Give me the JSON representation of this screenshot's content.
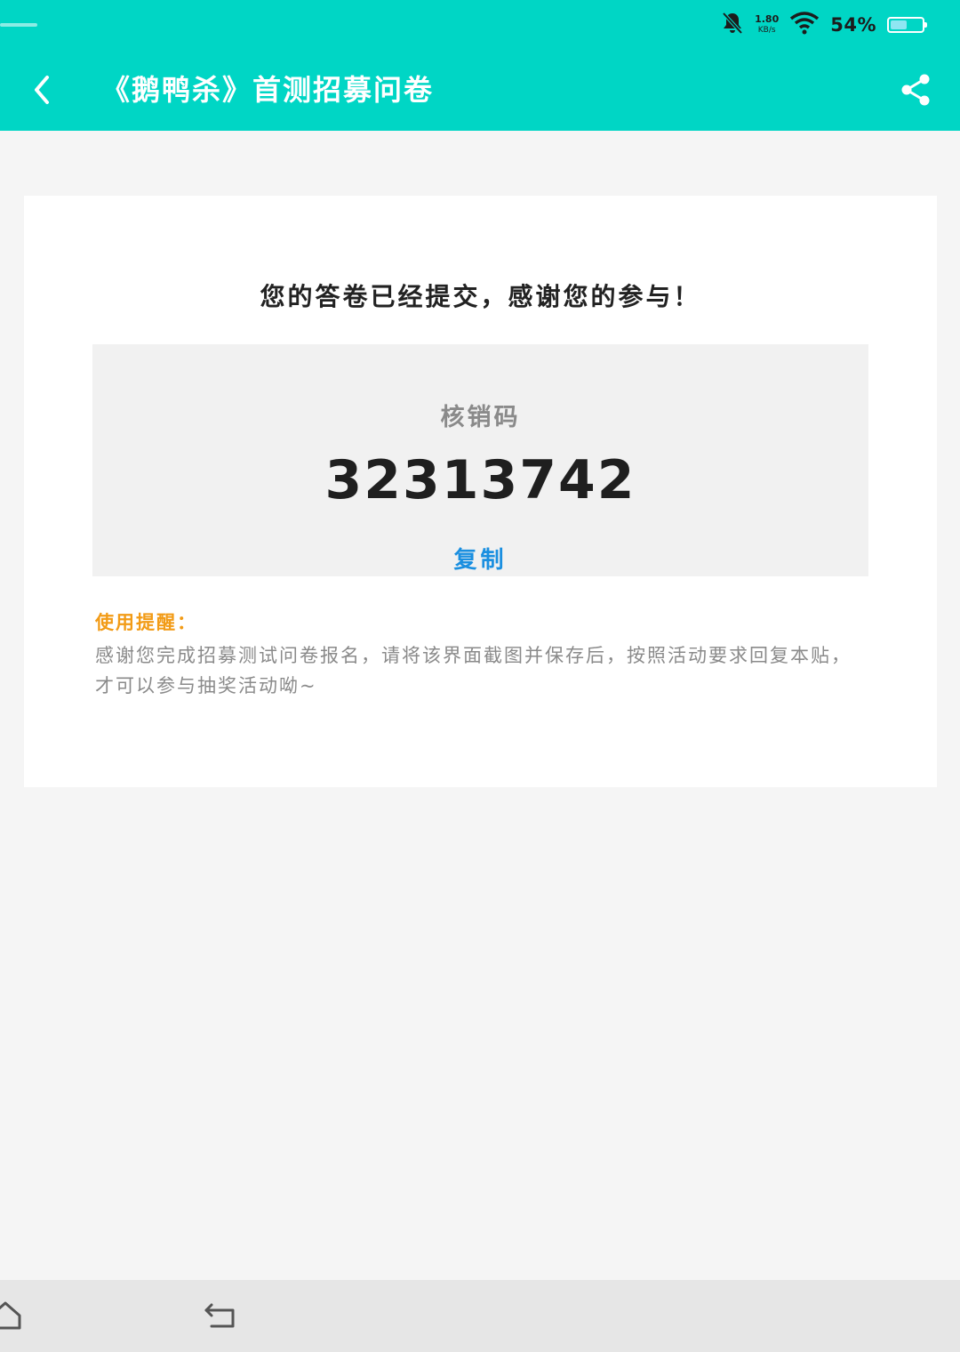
{
  "status_bar": {
    "net_speed_value": "1.80",
    "net_speed_unit": "KB/s",
    "battery_percent": "54%",
    "battery_level": 0.54,
    "icons": [
      "bell-off-icon",
      "wifi-icon",
      "battery-icon"
    ]
  },
  "app_bar": {
    "title": "《鹅鸭杀》首测招募问卷",
    "back_icon": "chevron-left-icon",
    "share_icon": "share-icon",
    "background_color": "#00d6c5"
  },
  "result": {
    "thanks_text": "您的答卷已经提交，感谢您的参与！",
    "code_label": "核销码",
    "code_value": "32313742",
    "copy_label": "复制",
    "tip_title": "使用提醒：",
    "tip_text": "感谢您完成招募测试问卷报名，请将该界面截图并保存后，按照活动要求回复本贴，才可以参与抽奖活动呦~"
  },
  "nav_bar": {
    "icons": [
      "home-icon",
      "back-icon"
    ]
  },
  "colors": {
    "accent": "#00d6c5",
    "link": "#1a8fe0",
    "warning": "#f29b16"
  }
}
